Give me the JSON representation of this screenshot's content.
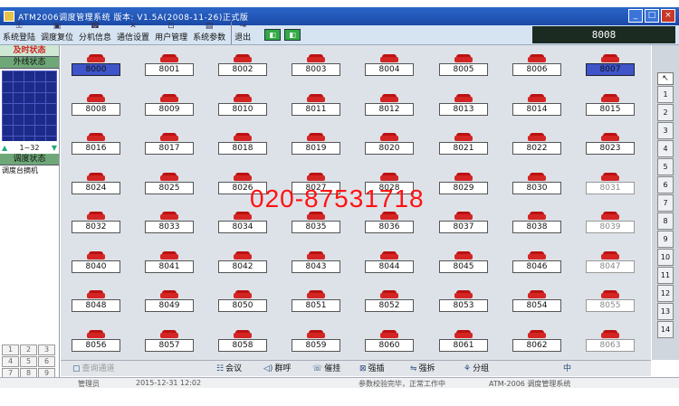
{
  "window": {
    "title": "ATM2006调度管理系统    版本: V1.5A(2008-11-26)正式版",
    "controls": [
      "_",
      "□",
      "×"
    ]
  },
  "toolbar": {
    "items": [
      {
        "label": "系统登陆",
        "icon": "key-icon"
      },
      {
        "label": "调度复位",
        "icon": "reset-icon"
      },
      {
        "label": "分机信息",
        "icon": "phone-info-icon"
      },
      {
        "label": "通信设置",
        "icon": "comm-settings-icon"
      },
      {
        "label": "用户管理",
        "icon": "user-manage-icon"
      },
      {
        "label": "系统参数",
        "icon": "params-icon"
      },
      {
        "label": "退出",
        "icon": "exit-icon"
      }
    ],
    "extension_display": "8008"
  },
  "left_panel": {
    "tab_realtime": "及时状态",
    "tab_external": "外线状态",
    "pager_range": "1~32",
    "tab_dispatch": "调度状态",
    "dispatch_item": "调度台摘机",
    "keypad": [
      "1",
      "2",
      "3",
      "4",
      "5",
      "6",
      "7",
      "8",
      "9"
    ]
  },
  "extensions": [
    {
      "number": "8000",
      "state": "active"
    },
    {
      "number": "8001",
      "state": "normal"
    },
    {
      "number": "8002",
      "state": "normal"
    },
    {
      "number": "8003",
      "state": "normal"
    },
    {
      "number": "8004",
      "state": "normal"
    },
    {
      "number": "8005",
      "state": "normal"
    },
    {
      "number": "8006",
      "state": "normal"
    },
    {
      "number": "8007",
      "state": "active"
    },
    {
      "number": "8008",
      "state": "normal"
    },
    {
      "number": "8009",
      "state": "normal"
    },
    {
      "number": "8010",
      "state": "normal"
    },
    {
      "number": "8011",
      "state": "normal"
    },
    {
      "number": "8012",
      "state": "normal"
    },
    {
      "number": "8013",
      "state": "normal"
    },
    {
      "number": "8014",
      "state": "normal"
    },
    {
      "number": "8015",
      "state": "normal"
    },
    {
      "number": "8016",
      "state": "normal"
    },
    {
      "number": "8017",
      "state": "normal"
    },
    {
      "number": "8018",
      "state": "normal"
    },
    {
      "number": "8019",
      "state": "normal"
    },
    {
      "number": "8020",
      "state": "normal"
    },
    {
      "number": "8021",
      "state": "normal"
    },
    {
      "number": "8022",
      "state": "normal"
    },
    {
      "number": "8023",
      "state": "normal"
    },
    {
      "number": "8024",
      "state": "normal"
    },
    {
      "number": "8025",
      "state": "normal"
    },
    {
      "number": "8026",
      "state": "normal"
    },
    {
      "number": "8027",
      "state": "normal"
    },
    {
      "number": "8028",
      "state": "normal"
    },
    {
      "number": "8029",
      "state": "normal"
    },
    {
      "number": "8030",
      "state": "normal"
    },
    {
      "number": "8031",
      "state": "faded"
    },
    {
      "number": "8032",
      "state": "normal"
    },
    {
      "number": "8033",
      "state": "normal"
    },
    {
      "number": "8034",
      "state": "normal"
    },
    {
      "number": "8035",
      "state": "normal"
    },
    {
      "number": "8036",
      "state": "normal"
    },
    {
      "number": "8037",
      "state": "normal"
    },
    {
      "number": "8038",
      "state": "normal"
    },
    {
      "number": "8039",
      "state": "faded"
    },
    {
      "number": "8040",
      "state": "normal"
    },
    {
      "number": "8041",
      "state": "normal"
    },
    {
      "number": "8042",
      "state": "normal"
    },
    {
      "number": "8043",
      "state": "normal"
    },
    {
      "number": "8044",
      "state": "normal"
    },
    {
      "number": "8045",
      "state": "normal"
    },
    {
      "number": "8046",
      "state": "normal"
    },
    {
      "number": "8047",
      "state": "faded"
    },
    {
      "number": "8048",
      "state": "normal"
    },
    {
      "number": "8049",
      "state": "normal"
    },
    {
      "number": "8050",
      "state": "normal"
    },
    {
      "number": "8051",
      "state": "normal"
    },
    {
      "number": "8052",
      "state": "normal"
    },
    {
      "number": "8053",
      "state": "normal"
    },
    {
      "number": "8054",
      "state": "normal"
    },
    {
      "number": "8055",
      "state": "faded"
    },
    {
      "number": "8056",
      "state": "normal"
    },
    {
      "number": "8057",
      "state": "normal"
    },
    {
      "number": "8058",
      "state": "normal"
    },
    {
      "number": "8059",
      "state": "normal"
    },
    {
      "number": "8060",
      "state": "normal"
    },
    {
      "number": "8061",
      "state": "normal"
    },
    {
      "number": "8062",
      "state": "normal"
    },
    {
      "number": "8063",
      "state": "faded"
    }
  ],
  "watermark": "020-87531718",
  "right_bar": {
    "pages": [
      "1",
      "2",
      "3",
      "4",
      "5",
      "6",
      "7",
      "8",
      "9",
      "10",
      "11",
      "12",
      "13",
      "14"
    ]
  },
  "action_bar": {
    "buttons": [
      {
        "label": "查询通道",
        "icon": "query-icon",
        "muted": true
      },
      {
        "label": "会议",
        "icon": "conference-icon",
        "muted": false
      },
      {
        "label": "群呼",
        "icon": "group-call-icon",
        "muted": false
      },
      {
        "label": "催挂",
        "icon": "hangup-icon",
        "muted": false
      },
      {
        "label": "强插",
        "icon": "barge-in-icon",
        "muted": false
      },
      {
        "label": "强拆",
        "icon": "force-release-icon",
        "muted": false
      },
      {
        "label": "分组",
        "icon": "group-icon",
        "muted": false
      }
    ],
    "ime_indicator": "中"
  },
  "status_bar": {
    "operator": "管理员",
    "datetime": "2015-12-31  12:02",
    "message": "参数校验完毕，正常工作中",
    "product": "ATM-2006 调度管理系统"
  }
}
